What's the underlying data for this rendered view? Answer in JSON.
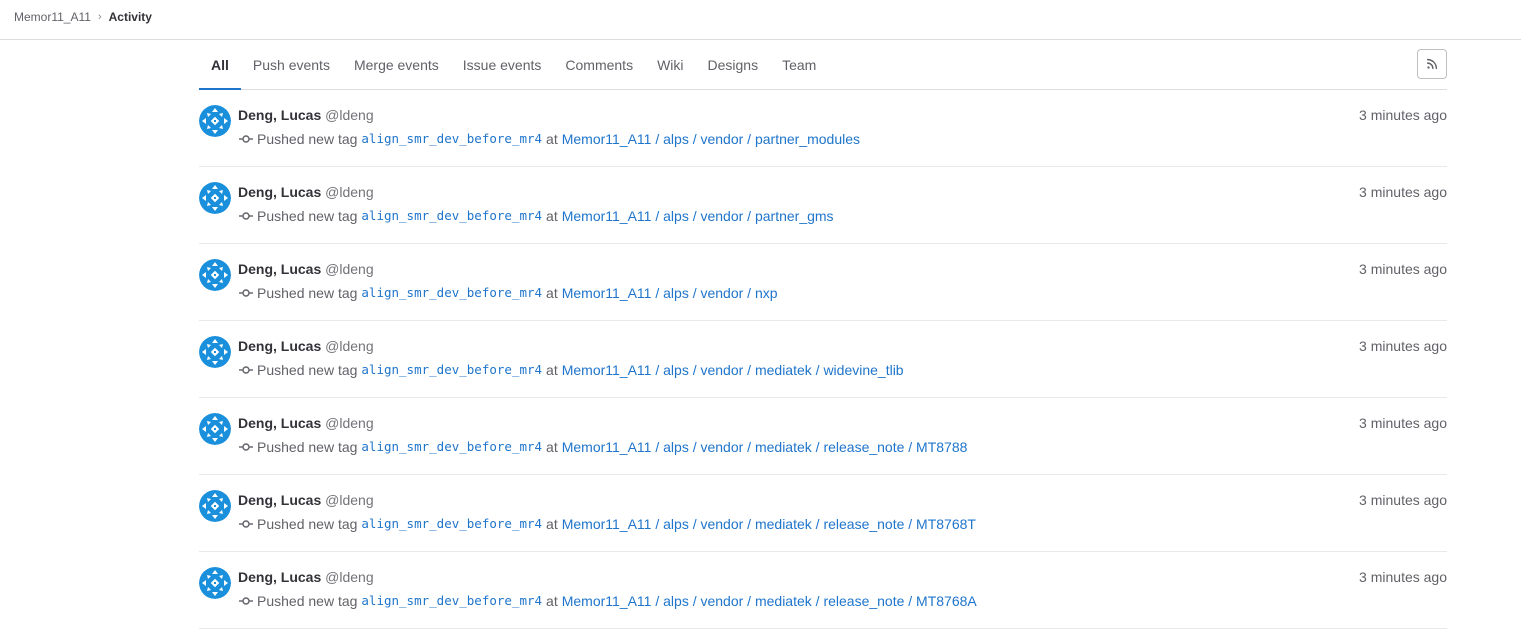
{
  "breadcrumb": {
    "project": "Memor11_A11",
    "current": "Activity"
  },
  "tabs": [
    {
      "label": "All",
      "active": true
    },
    {
      "label": "Push events"
    },
    {
      "label": "Merge events"
    },
    {
      "label": "Issue events"
    },
    {
      "label": "Comments"
    },
    {
      "label": "Wiki"
    },
    {
      "label": "Designs"
    },
    {
      "label": "Team"
    }
  ],
  "rss_icon": "rss-icon",
  "events": [
    {
      "author": "Deng, Lucas",
      "username": "@ldeng",
      "action": "Pushed new tag",
      "tag": "align_smr_dev_before_mr4",
      "at": "at",
      "project": "Memor11_A11 / alps / vendor / partner_modules",
      "time": "3 minutes ago"
    },
    {
      "author": "Deng, Lucas",
      "username": "@ldeng",
      "action": "Pushed new tag",
      "tag": "align_smr_dev_before_mr4",
      "at": "at",
      "project": "Memor11_A11 / alps / vendor / partner_gms",
      "time": "3 minutes ago"
    },
    {
      "author": "Deng, Lucas",
      "username": "@ldeng",
      "action": "Pushed new tag",
      "tag": "align_smr_dev_before_mr4",
      "at": "at",
      "project": "Memor11_A11 / alps / vendor / nxp",
      "time": "3 minutes ago"
    },
    {
      "author": "Deng, Lucas",
      "username": "@ldeng",
      "action": "Pushed new tag",
      "tag": "align_smr_dev_before_mr4",
      "at": "at",
      "project": "Memor11_A11 / alps / vendor / mediatek / widevine_tlib",
      "time": "3 minutes ago"
    },
    {
      "author": "Deng, Lucas",
      "username": "@ldeng",
      "action": "Pushed new tag",
      "tag": "align_smr_dev_before_mr4",
      "at": "at",
      "project": "Memor11_A11 / alps / vendor / mediatek / release_note / MT8788",
      "time": "3 minutes ago"
    },
    {
      "author": "Deng, Lucas",
      "username": "@ldeng",
      "action": "Pushed new tag",
      "tag": "align_smr_dev_before_mr4",
      "at": "at",
      "project": "Memor11_A11 / alps / vendor / mediatek / release_note / MT8768T",
      "time": "3 minutes ago"
    },
    {
      "author": "Deng, Lucas",
      "username": "@ldeng",
      "action": "Pushed new tag",
      "tag": "align_smr_dev_before_mr4",
      "at": "at",
      "project": "Memor11_A11 / alps / vendor / mediatek / release_note / MT8768A",
      "time": "3 minutes ago"
    }
  ],
  "colors": {
    "link": "#1f75cb",
    "avatar": "#1a8fdb",
    "active_tab_underline": "#1f75cb"
  }
}
